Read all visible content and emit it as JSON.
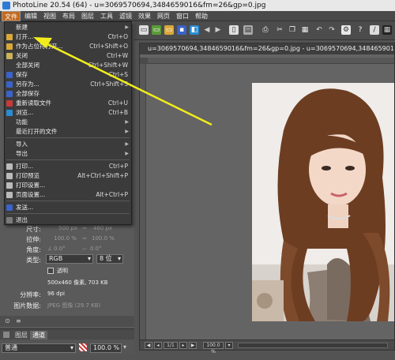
{
  "window": {
    "title": "PhotoLine 20.54 (64) - u=3069570694,3484659016&fm=26&gp=0.jpg"
  },
  "menubar": [
    "文件",
    "编辑",
    "视图",
    "布局",
    "图层",
    "工具",
    "滤镜",
    "效果",
    "网页",
    "窗口",
    "帮助"
  ],
  "file_menu": [
    {
      "label": "新建",
      "shortcut": "",
      "arrow": true,
      "icon": ""
    },
    {
      "label": "打开...",
      "shortcut": "Ctrl+O",
      "icon": "#d9a93a"
    },
    {
      "label": "作为占位符打开...",
      "shortcut": "Ctrl+Shift+O",
      "icon": "#d9a93a"
    },
    {
      "label": "关闭",
      "shortcut": "Ctrl+W",
      "icon": "#c8b35a"
    },
    {
      "label": "全部关闭",
      "shortcut": "Ctrl+Shift+W",
      "icon": ""
    },
    {
      "label": "保存",
      "shortcut": "Ctrl+S",
      "icon": "#3a63c9"
    },
    {
      "label": "另存为...",
      "shortcut": "Ctrl+Shift+S",
      "icon": "#3a63c9"
    },
    {
      "label": "全部保存",
      "shortcut": "",
      "icon": "#3a63c9"
    },
    {
      "label": "重新读取文件",
      "shortcut": "Ctrl+U",
      "icon": "#c83a3a"
    },
    {
      "label": "浏览...",
      "shortcut": "Ctrl+B",
      "icon": "#2a8bd0"
    },
    {
      "label": "功能",
      "shortcut": "",
      "arrow": true,
      "icon": ""
    },
    {
      "label": "最近打开的文件",
      "shortcut": "",
      "arrow": true,
      "icon": ""
    },
    {
      "label": "导入",
      "shortcut": "",
      "arrow": true,
      "icon": ""
    },
    {
      "label": "导出",
      "shortcut": "",
      "arrow": true,
      "icon": ""
    },
    {
      "label": "打印...",
      "shortcut": "Ctrl+P",
      "icon": "#bbbbbb"
    },
    {
      "label": "打印预览",
      "shortcut": "Alt+Ctrl+Shift+P",
      "icon": "#bbbbbb"
    },
    {
      "label": "打印设置...",
      "shortcut": "",
      "icon": "#bbbbbb"
    },
    {
      "label": "页面设置...",
      "shortcut": "Alt+Ctrl+P",
      "icon": "#bbbbbb"
    },
    {
      "label": "发送...",
      "shortcut": "",
      "icon": "#3a63c9"
    },
    {
      "label": "退出",
      "shortcut": "",
      "icon": "#7a7a7a"
    }
  ],
  "document": {
    "tab_title": "u=3069570694,3484659016&fm=26&gp=0.jpg - u=3069570694,3484659016&fm=26&gp=0.jpg",
    "page": "1/1",
    "zoom": "100.0 %"
  },
  "props": {
    "size_label": "尺寸:",
    "size_w": "500 px",
    "size_h": "460 px",
    "scale_label": "拉伸:",
    "scale_w": "100.0 %",
    "scale_h": "100.0 %",
    "angle_label": "角度:",
    "angle_a": "0.0°",
    "angle_b": "0.0°",
    "type_label": "类型:",
    "type_value": "RGB",
    "bits_value": "8 位",
    "transparent_label": "透明",
    "info": "500x460 像素, 703 KB",
    "res_label": "分辨率:",
    "res_value": "96 dpi",
    "imgdata_label": "图片数据:",
    "imgdata_value": "JPEG 图像 (29.7 KB)"
  },
  "layers": {
    "tabs": [
      "图层",
      "通道"
    ],
    "blend": "普通",
    "opacity": "100.0 %"
  },
  "colors": {
    "accent": "#c46a1e",
    "arrow": "#f2ec1c"
  }
}
